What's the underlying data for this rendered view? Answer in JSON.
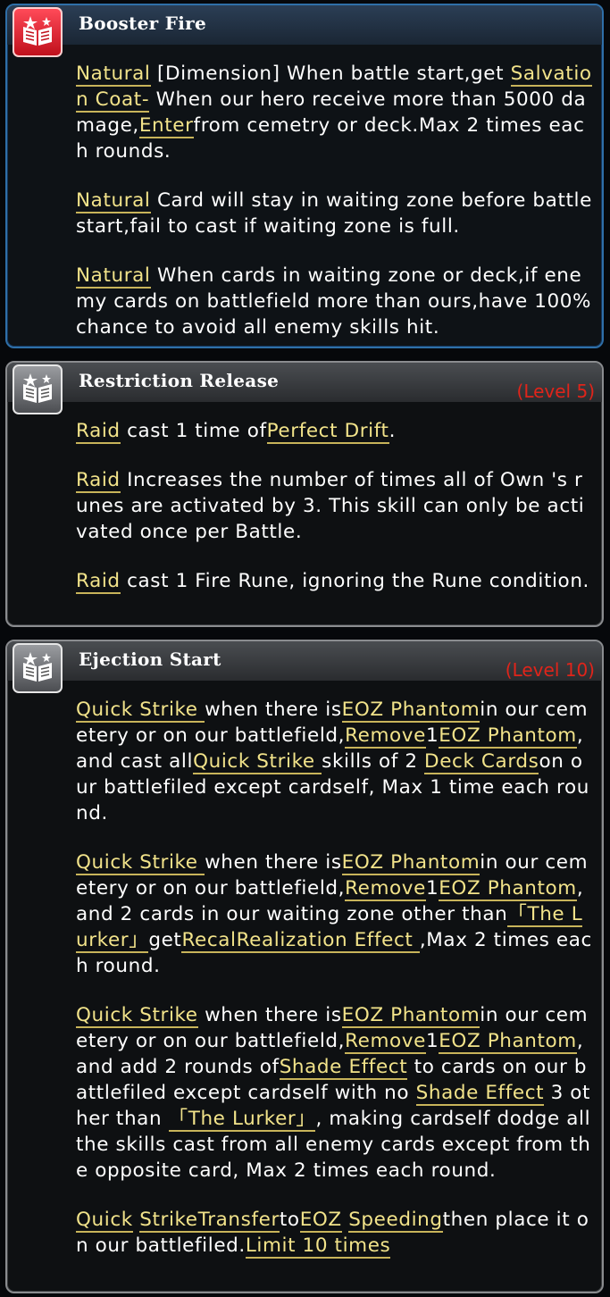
{
  "skills": [
    {
      "title": "Booster Fire",
      "level": "",
      "icon": "book-stars-icon-red",
      "paragraphs": [
        [
          {
            "t": "Natural",
            "kw": true
          },
          {
            "t": " [Dimension] When battle start,get "
          },
          {
            "t": "Salvation Coat-",
            "kw": true
          },
          {
            "t": " When our hero receive more than 5000 damage,"
          },
          {
            "t": "Enter",
            "kw": true
          },
          {
            "t": "from cemetry or deck.Max 2 times each rounds."
          }
        ],
        [
          {
            "t": "Natural",
            "kw": true
          },
          {
            "t": " Card will stay in waiting zone before battle start,fail to cast if waiting zone is full."
          }
        ],
        [
          {
            "t": "Natural",
            "kw": true
          },
          {
            "t": " When cards in waiting zone or deck,if enemy cards on battlefield more than ours,have 100% chance to avoid all enemy skills hit."
          }
        ]
      ]
    },
    {
      "title": "Restriction Release",
      "level": "(Level 5)",
      "icon": "book-stars-icon-grey",
      "paragraphs": [
        [
          {
            "t": "Raid",
            "kw": true
          },
          {
            "t": " cast 1 time of"
          },
          {
            "t": "Perfect Drift",
            "kw": true
          },
          {
            "t": "."
          }
        ],
        [
          {
            "t": "Raid",
            "kw": true
          },
          {
            "t": "  Increases the number of times all of Own 's runes are activated by 3. This skill can only be activated once per Battle."
          }
        ],
        [
          {
            "t": "Raid",
            "kw": true
          },
          {
            "t": " cast 1 Fire Rune, ignoring the Rune condition."
          }
        ]
      ]
    },
    {
      "title": "Ejection Start",
      "level": "(Level 10)",
      "icon": "book-stars-icon-grey",
      "paragraphs": [
        [
          {
            "t": "Quick Strike ",
            "kw": true
          },
          {
            "t": " when there is"
          },
          {
            "t": "EOZ Phantom",
            "kw": true
          },
          {
            "t": "in our cemetery or on our battlefield,"
          },
          {
            "t": "Remove",
            "kw": true
          },
          {
            "t": "1"
          },
          {
            "t": "EOZ Phantom",
            "kw": true
          },
          {
            "t": ", and cast all"
          },
          {
            "t": "Quick Strike ",
            "kw": true
          },
          {
            "t": " skills of 2 "
          },
          {
            "t": "Deck Cards",
            "kw": true
          },
          {
            "t": "on our battlefiled except cardself, Max 1 time each round."
          }
        ],
        [
          {
            "t": "Quick Strike ",
            "kw": true
          },
          {
            "t": " when there is"
          },
          {
            "t": "EOZ Phantom",
            "kw": true
          },
          {
            "t": "in our cemetery or on our battlefield,"
          },
          {
            "t": "Remove",
            "kw": true
          },
          {
            "t": "1"
          },
          {
            "t": "EOZ Phantom",
            "kw": true
          },
          {
            "t": ", and 2 cards in our waiting zone other than"
          },
          {
            "t": "「The Lurker」",
            "kw": true
          },
          {
            "t": "get"
          },
          {
            "t": "RecalRealization Effect ",
            "kw": true
          },
          {
            "t": ",Max 2 times each round."
          }
        ],
        [
          {
            "t": "Quick Strike",
            "kw": true
          },
          {
            "t": " when there is"
          },
          {
            "t": "EOZ Phantom",
            "kw": true
          },
          {
            "t": "in our cemetery or on our battlefield,"
          },
          {
            "t": "Remove",
            "kw": true
          },
          {
            "t": "1"
          },
          {
            "t": "EOZ Phantom",
            "kw": true
          },
          {
            "t": ", and add 2 rounds of"
          },
          {
            "t": "Shade Effect",
            "kw": true
          },
          {
            "t": " to cards on our battlefiled except cardself with no "
          },
          {
            "t": "Shade Effect",
            "kw": true
          },
          {
            "t": " 3 other than "
          },
          {
            "t": "「The Lurker」",
            "kw": true
          },
          {
            "t": ", making cardself dodge all the skills cast from all enemy cards except from the opposite card, Max 2 times each round."
          }
        ],
        [
          {
            "t": "Quick",
            "kw": true
          },
          {
            "t": " "
          },
          {
            "t": "Strike",
            "kw": true
          },
          {
            "t": "Transfer",
            "kw": true
          },
          {
            "t": "to"
          },
          {
            "t": "EOZ",
            "kw": true
          },
          {
            "t": " "
          },
          {
            "t": "Speeding",
            "kw": true
          },
          {
            "t": "then place it on our battlefiled."
          },
          {
            "t": "Limit 10 times",
            "kw": true
          }
        ]
      ]
    }
  ]
}
